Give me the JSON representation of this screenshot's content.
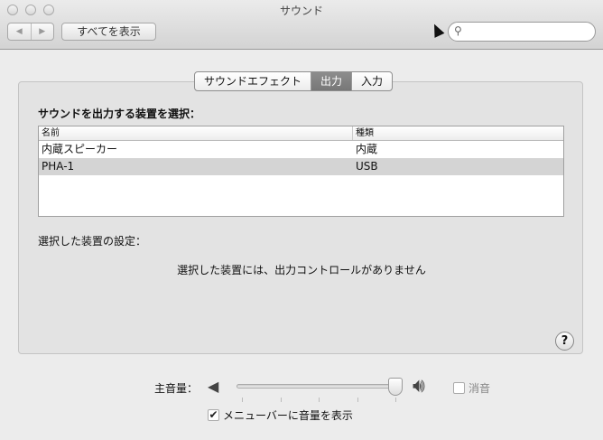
{
  "window": {
    "title": "サウンド"
  },
  "toolbar": {
    "back": "◀",
    "forward": "▶",
    "show_all": "すべてを表示",
    "search_placeholder": "",
    "search_icon": "magnifier"
  },
  "tabs": [
    {
      "label": "サウンドエフェクト",
      "active": false
    },
    {
      "label": "出力",
      "active": true
    },
    {
      "label": "入力",
      "active": false
    }
  ],
  "output": {
    "heading": "サウンドを出力する装置を選択：",
    "columns": [
      "名前",
      "種類"
    ],
    "rows": [
      {
        "name": "内蔵スピーカー",
        "type": "内蔵",
        "selected": false
      },
      {
        "name": "PHA-1",
        "type": "USB",
        "selected": true
      }
    ],
    "settings_label": "選択した装置の設定：",
    "no_controls": "選択した装置には、出力コントロールがありません"
  },
  "help": "?",
  "volume": {
    "label": "主音量：",
    "value": 1.0,
    "mute_label": "消音",
    "muted": false,
    "show_in_menubar_label": "メニューバーに音量を表示",
    "show_in_menubar": true
  }
}
